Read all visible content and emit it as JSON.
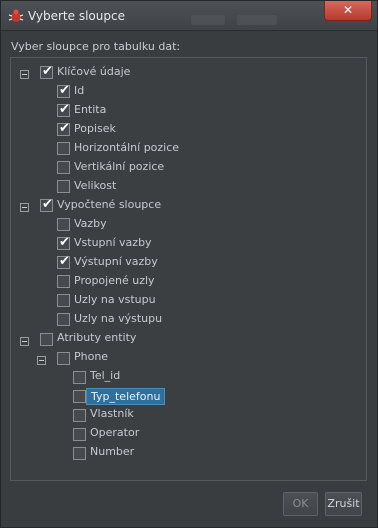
{
  "window": {
    "title": "Vyberte sloupce",
    "close_label": "✕",
    "app_icon": "bug-icon"
  },
  "instructions": "Vyber sloupce pro tabulku dat:",
  "tree": {
    "groups": [
      {
        "label": "Klíčové údaje",
        "checked": true,
        "expanded": true,
        "items": [
          {
            "label": "Id",
            "checked": true
          },
          {
            "label": "Entita",
            "checked": true
          },
          {
            "label": "Popisek",
            "checked": true
          },
          {
            "label": "Horizontální pozice",
            "checked": false
          },
          {
            "label": "Vertikální pozice",
            "checked": false
          },
          {
            "label": "Velikost",
            "checked": false
          }
        ]
      },
      {
        "label": "Vypočtené sloupce",
        "checked": true,
        "expanded": true,
        "items": [
          {
            "label": "Vazby",
            "checked": false
          },
          {
            "label": "Vstupní vazby",
            "checked": true
          },
          {
            "label": "Výstupní vazby",
            "checked": true
          },
          {
            "label": "Propojené uzly",
            "checked": false
          },
          {
            "label": "Uzly na vstupu",
            "checked": false
          },
          {
            "label": "Uzly na výstupu",
            "checked": false
          }
        ]
      },
      {
        "label": "Atributy entity",
        "checked": false,
        "expanded": true,
        "subgroup": {
          "label": "Phone",
          "checked": false,
          "expanded": true,
          "items": [
            {
              "label": "Tel_id",
              "checked": false
            },
            {
              "label": "Typ_telefonu",
              "checked": false,
              "selected": true
            },
            {
              "label": "Vlastník",
              "checked": false
            },
            {
              "label": "Operator",
              "checked": false
            },
            {
              "label": "Number",
              "checked": false
            }
          ]
        }
      }
    ]
  },
  "buttons": {
    "ok_label": "OK",
    "ok_enabled": false,
    "cancel_label": "Zrušit"
  }
}
